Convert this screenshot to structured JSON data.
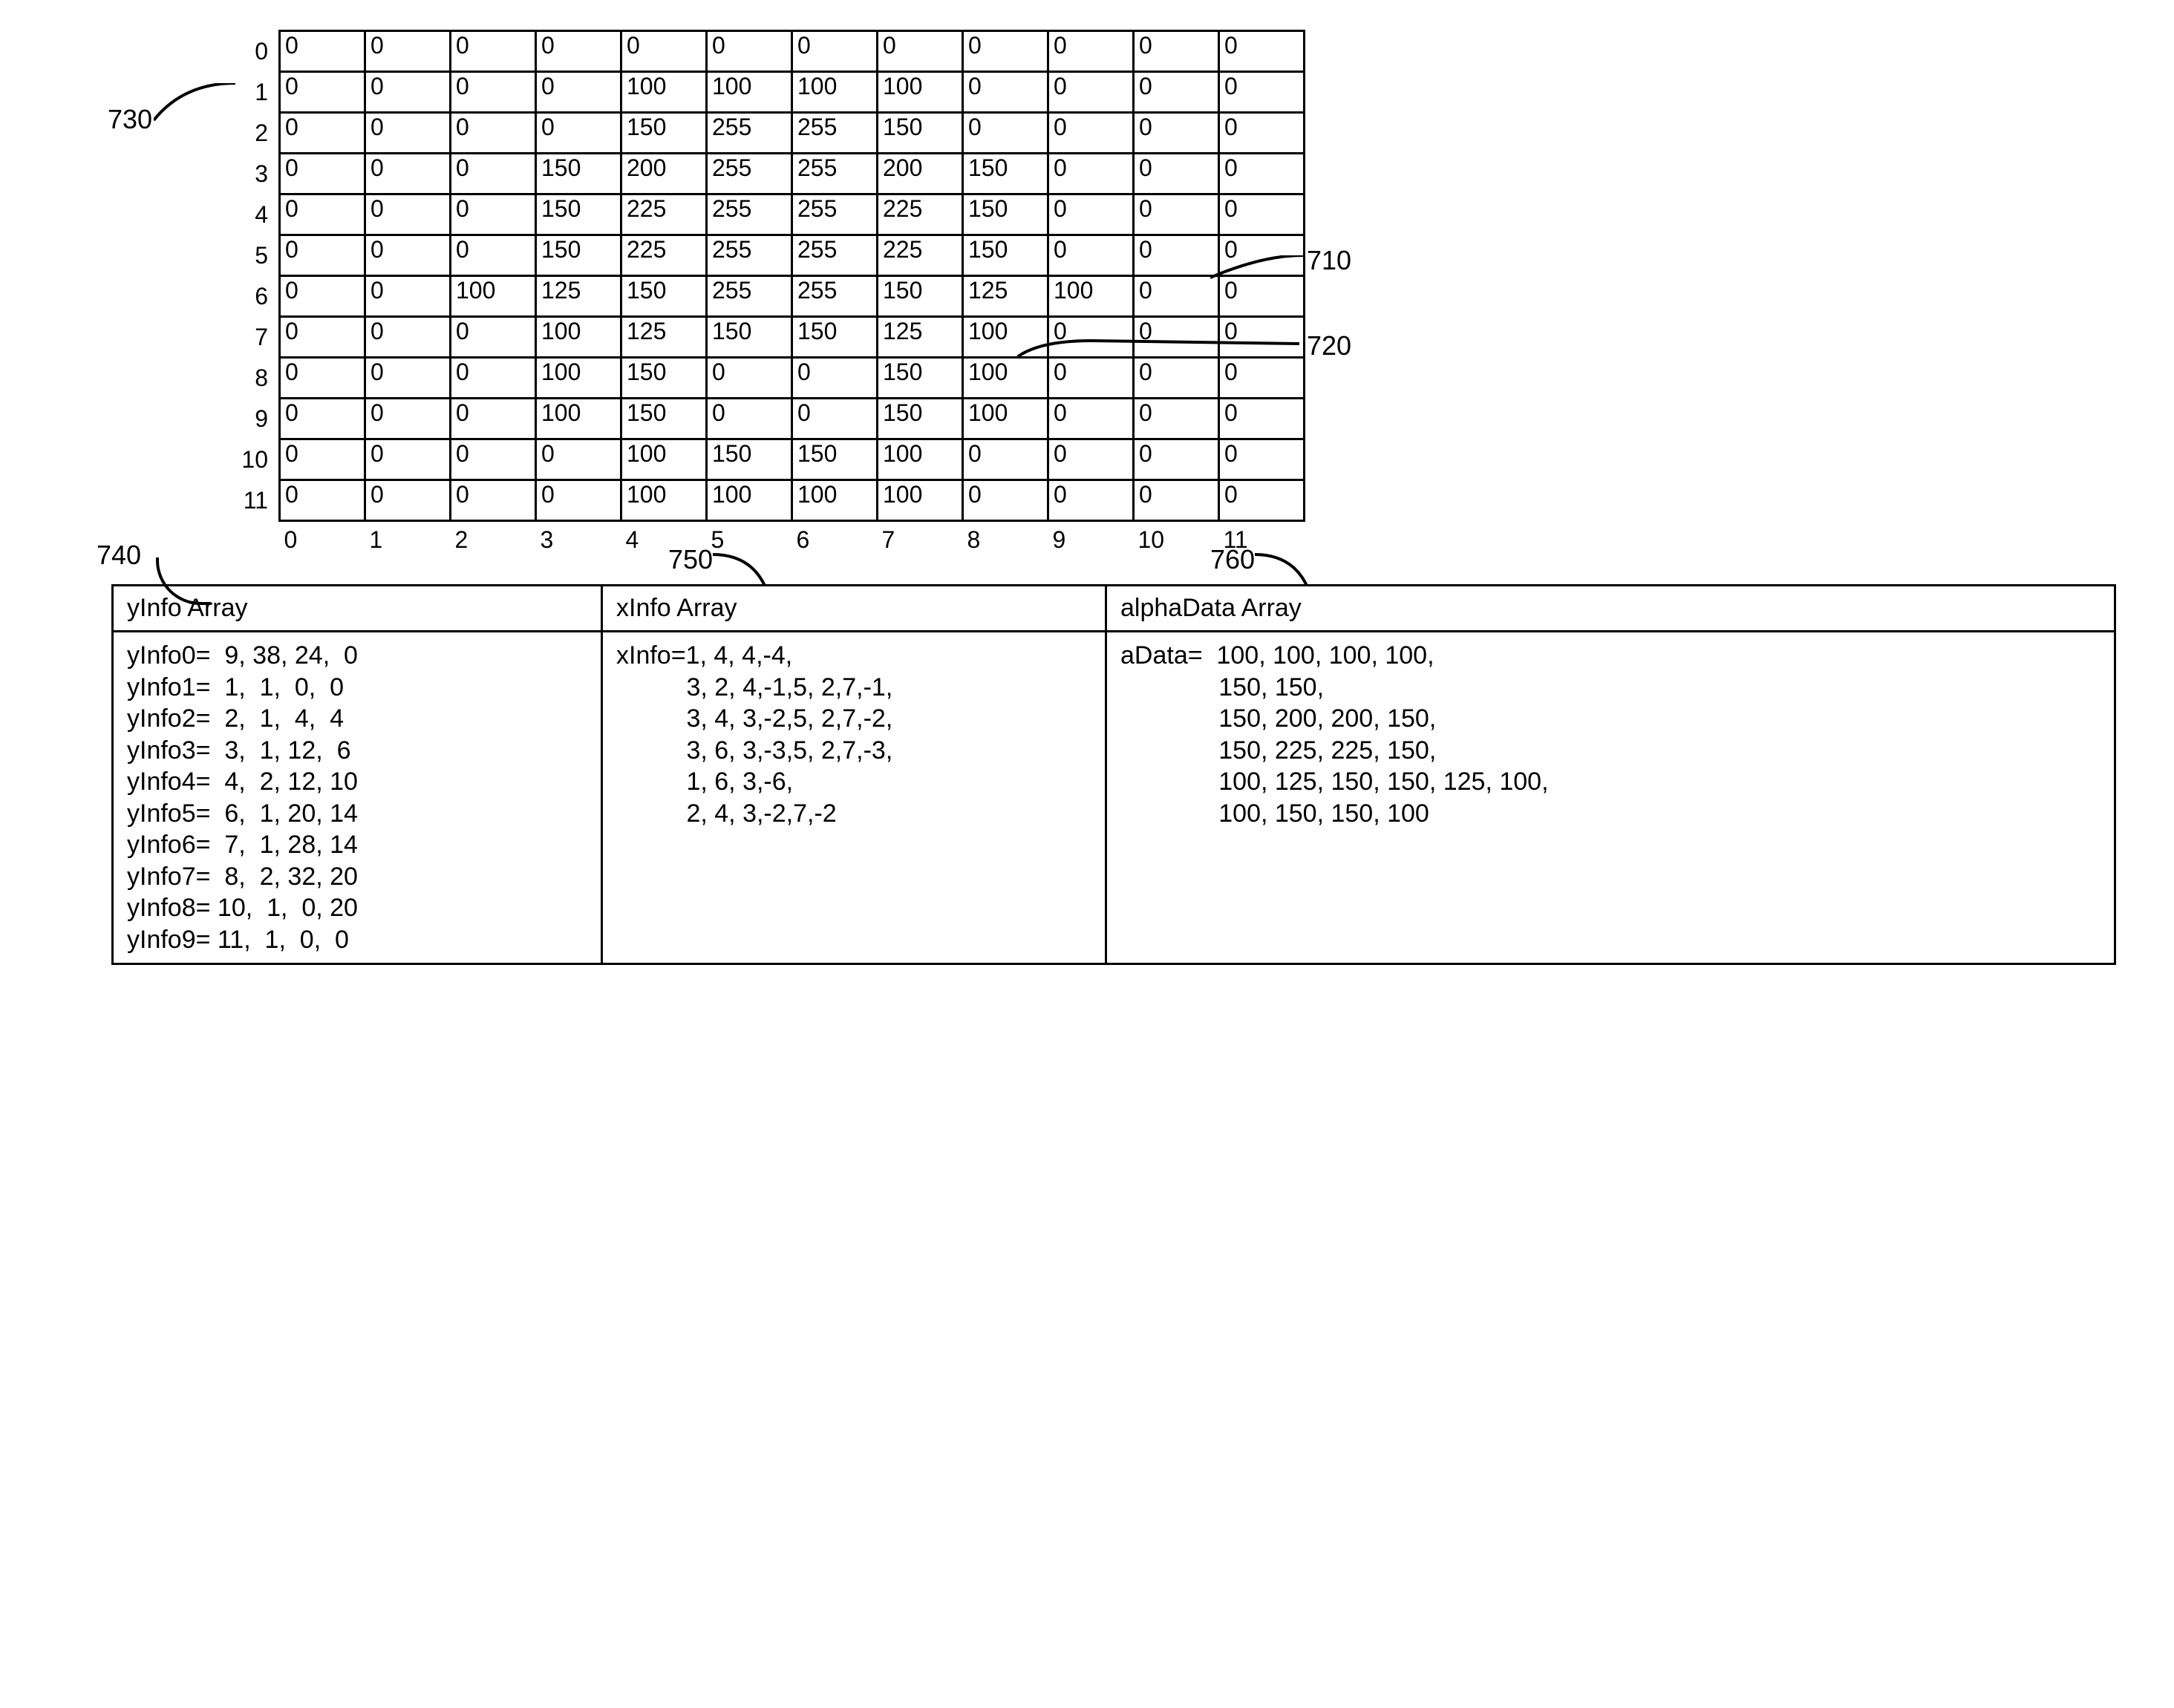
{
  "callouts": {
    "c730": "730",
    "c710": "710",
    "c720": "720",
    "c740": "740",
    "c750": "750",
    "c760": "760"
  },
  "grid": {
    "rows": [
      {
        "label": "0",
        "cells": [
          "0",
          "0",
          "0",
          "0",
          "0",
          "0",
          "0",
          "0",
          "0",
          "0",
          "0",
          "0"
        ]
      },
      {
        "label": "1",
        "cells": [
          "0",
          "0",
          "0",
          "0",
          "100",
          "100",
          "100",
          "100",
          "0",
          "0",
          "0",
          "0"
        ]
      },
      {
        "label": "2",
        "cells": [
          "0",
          "0",
          "0",
          "0",
          "150",
          "255",
          "255",
          "150",
          "0",
          "0",
          "0",
          "0"
        ]
      },
      {
        "label": "3",
        "cells": [
          "0",
          "0",
          "0",
          "150",
          "200",
          "255",
          "255",
          "200",
          "150",
          "0",
          "0",
          "0"
        ]
      },
      {
        "label": "4",
        "cells": [
          "0",
          "0",
          "0",
          "150",
          "225",
          "255",
          "255",
          "225",
          "150",
          "0",
          "0",
          "0"
        ]
      },
      {
        "label": "5",
        "cells": [
          "0",
          "0",
          "0",
          "150",
          "225",
          "255",
          "255",
          "225",
          "150",
          "0",
          "0",
          "0"
        ]
      },
      {
        "label": "6",
        "cells": [
          "0",
          "0",
          "100",
          "125",
          "150",
          "255",
          "255",
          "150",
          "125",
          "100",
          "0",
          "0"
        ]
      },
      {
        "label": "7",
        "cells": [
          "0",
          "0",
          "0",
          "100",
          "125",
          "150",
          "150",
          "125",
          "100",
          "0",
          "0",
          "0"
        ]
      },
      {
        "label": "8",
        "cells": [
          "0",
          "0",
          "0",
          "100",
          "150",
          "0",
          "0",
          "150",
          "100",
          "0",
          "0",
          "0"
        ]
      },
      {
        "label": "9",
        "cells": [
          "0",
          "0",
          "0",
          "100",
          "150",
          "0",
          "0",
          "150",
          "100",
          "0",
          "0",
          "0"
        ]
      },
      {
        "label": "10",
        "cells": [
          "0",
          "0",
          "0",
          "0",
          "100",
          "150",
          "150",
          "100",
          "0",
          "0",
          "0",
          "0"
        ]
      },
      {
        "label": "11",
        "cells": [
          "0",
          "0",
          "0",
          "0",
          "100",
          "100",
          "100",
          "100",
          "0",
          "0",
          "0",
          "0"
        ]
      }
    ],
    "cols": [
      "0",
      "1",
      "2",
      "3",
      "4",
      "5",
      "6",
      "7",
      "8",
      "9",
      "10",
      "11"
    ]
  },
  "arrays": {
    "yinfo": {
      "title": "yInfo Array",
      "lines": [
        "yInfo0=  9, 38, 24,  0",
        "yInfo1=  1,  1,  0,  0",
        "yInfo2=  2,  1,  4,  4",
        "yInfo3=  3,  1, 12,  6",
        "yInfo4=  4,  2, 12, 10",
        "yInfo5=  6,  1, 20, 14",
        "yInfo6=  7,  1, 28, 14",
        "yInfo7=  8,  2, 32, 20",
        "yInfo8= 10,  1,  0, 20",
        "yInfo9= 11,  1,  0,  0"
      ]
    },
    "xinfo": {
      "title": "xInfo Array",
      "lines": [
        "xInfo=1, 4, 4,-4,",
        "          3, 2, 4,-1,5, 2,7,-1,",
        "          3, 4, 3,-2,5, 2,7,-2,",
        "          3, 6, 3,-3,5, 2,7,-3,",
        "          1, 6, 3,-6,",
        "          2, 4, 3,-2,7,-2"
      ]
    },
    "adata": {
      "title": "alphaData Array",
      "lines": [
        "aData=  100, 100, 100, 100,",
        "              150, 150,",
        "              150, 200, 200, 150,",
        "              150, 225, 225, 150,",
        "              100, 125, 150, 150, 125, 100,",
        "              100, 150, 150, 100"
      ]
    }
  }
}
